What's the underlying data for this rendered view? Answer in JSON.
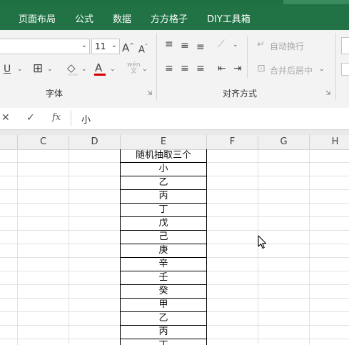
{
  "ribbon_tabs": [
    "页面布局",
    "公式",
    "数据",
    "方方格子",
    "DIY工具箱"
  ],
  "font": {
    "size": "11",
    "group_label": "字体",
    "underline_icon": "U",
    "font_color_icon": "A",
    "grow_icon": "A",
    "shrink_icon": "A"
  },
  "alignment": {
    "group_label": "对齐方式",
    "wrap_text": "自动换行",
    "merge_center": "合并后居中"
  },
  "formula_bar": {
    "cancel": "✕",
    "enter": "✓",
    "fx": "fx",
    "value": "小"
  },
  "columns": [
    "C",
    "D",
    "E",
    "F",
    "G",
    "H"
  ],
  "column_e": [
    "随机抽取三个",
    "小",
    "乙",
    "丙",
    "丁",
    "戊",
    "己",
    "庚",
    "辛",
    "壬",
    "癸",
    "甲",
    "乙",
    "丙",
    "丁"
  ],
  "colors": {
    "ribbon_green": "#217346",
    "font_color_red": "#d40000"
  }
}
